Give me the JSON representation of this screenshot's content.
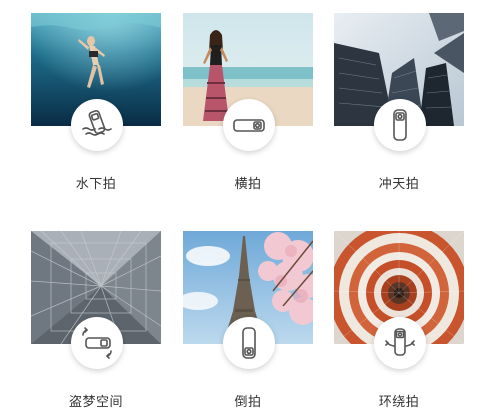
{
  "modes": [
    {
      "label": "水下拍",
      "photo": "underwater-swimmer-photo",
      "icon": "camera-in-water-icon"
    },
    {
      "label": "横拍",
      "photo": "beach-woman-photo",
      "icon": "camera-horizontal-icon"
    },
    {
      "label": "冲天拍",
      "photo": "skyscrapers-photo",
      "icon": "camera-vertical-icon"
    },
    {
      "label": "盗梦空间",
      "photo": "metal-grid-structure-photo",
      "icon": "camera-rotate-horizontal-icon"
    },
    {
      "label": "倒拍",
      "photo": "eiffel-tower-blossom-photo",
      "icon": "camera-inverted-icon"
    },
    {
      "label": "环绕拍",
      "photo": "spiral-staircase-photo",
      "icon": "camera-orbit-icon"
    }
  ]
}
